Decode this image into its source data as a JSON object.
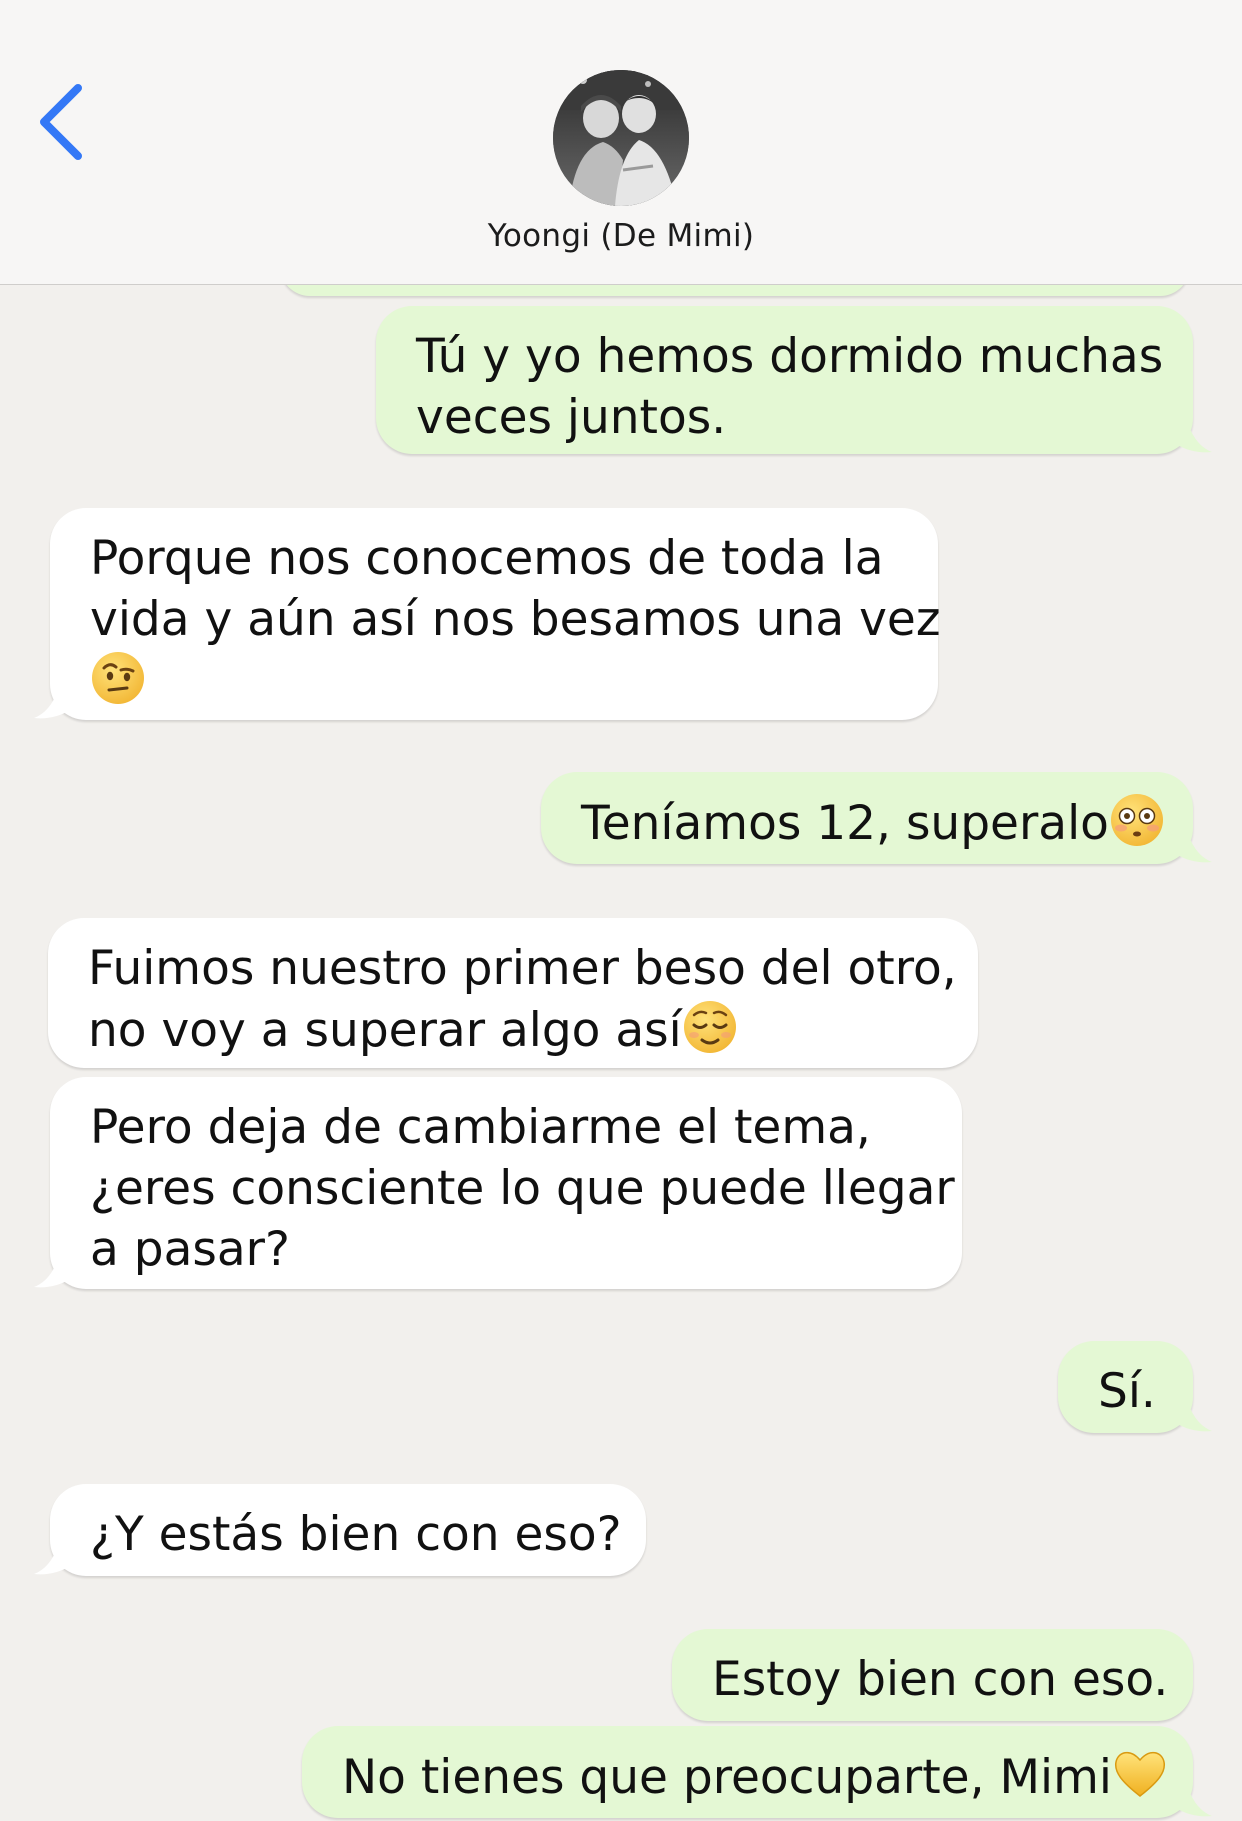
{
  "header": {
    "back_icon": "chevron-left-icon",
    "contact_name": "Yoongi (De Mimi)",
    "accent_color": "#3478f6"
  },
  "messages": [
    {
      "direction": "outgoing",
      "lines": [
        "Tú y yo hemos dormido muchas",
        "veces juntos."
      ]
    },
    {
      "direction": "incoming",
      "lines": [
        "Porque nos conocemos de toda la",
        "vida y aún así nos besamos una vez"
      ],
      "emoji": "face-with-raised-eyebrow"
    },
    {
      "direction": "outgoing",
      "text": "Teníamos 12, superalo",
      "emoji": "flushed-face"
    },
    {
      "direction": "incoming",
      "lines": [
        "Fuimos nuestro primer beso del otro,",
        "no voy a superar algo así"
      ],
      "emoji": "relieved-face"
    },
    {
      "direction": "incoming",
      "lines": [
        "Pero deja de cambiarme el tema,",
        "¿eres consciente lo que puede llegar",
        "a pasar?"
      ]
    },
    {
      "direction": "outgoing",
      "text": "Sí."
    },
    {
      "direction": "incoming",
      "text": "¿Y estás bien con eso?"
    },
    {
      "direction": "outgoing",
      "text": "Estoy bien con eso."
    },
    {
      "direction": "outgoing",
      "text": "No tienes que preocuparte, Mimi",
      "emoji": "yellow-heart"
    }
  ],
  "colors": {
    "background": "#f2f0ed",
    "outgoing_bubble": "#e4f8d4",
    "incoming_bubble": "#ffffff"
  }
}
